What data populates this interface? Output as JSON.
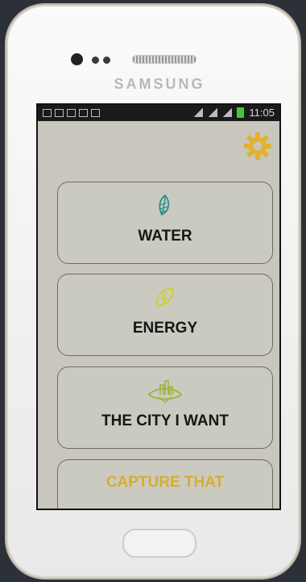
{
  "device": {
    "brand": "SAMSUNG"
  },
  "status_bar": {
    "time": "11:05",
    "battery_color": "#46c637"
  },
  "settings": {
    "icon": "gear-icon",
    "color": "#e2b12f"
  },
  "menu": {
    "items": [
      {
        "label": "WATER",
        "icon": "water-leaf-icon",
        "icon_color": "#2f8d8c"
      },
      {
        "label": "ENERGY",
        "icon": "energy-leaf-icon",
        "icon_color": "#d0cf1f"
      },
      {
        "label": "THE CITY I WANT",
        "icon": "city-icon",
        "icon_color": "#9bb33a"
      },
      {
        "label": "CAPTURE THAT",
        "label_color": "#d8ad2b"
      }
    ]
  }
}
